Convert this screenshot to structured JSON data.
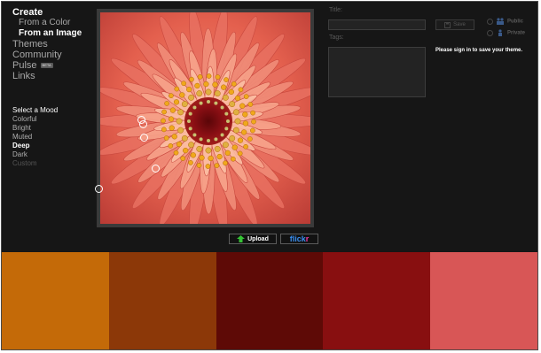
{
  "nav": {
    "create": "Create",
    "from_color": "From a Color",
    "from_image": "From an Image",
    "themes": "Themes",
    "community": "Community",
    "pulse": "Pulse",
    "beta": "BETA",
    "links": "Links"
  },
  "mood": {
    "title": "Select a Mood",
    "items": [
      "Colorful",
      "Bright",
      "Muted",
      "Deep",
      "Dark",
      "Custom"
    ],
    "selected": "Deep"
  },
  "form": {
    "title_label": "Title:",
    "tags_label": "Tags:",
    "save_label": "Save",
    "public_label": "Public",
    "private_label": "Private",
    "signin_text": "Please sign in to save your theme."
  },
  "buttons": {
    "upload": "Upload",
    "flickr_main": "flick",
    "flickr_r": "r"
  },
  "swatches": [
    "#c46a08",
    "#8c3808",
    "#5e0a06",
    "#880f10",
    "#d85656"
  ],
  "colors": {
    "petal": "#e8705e",
    "stamen": "#f0a81c",
    "center": "#8a0f14"
  }
}
